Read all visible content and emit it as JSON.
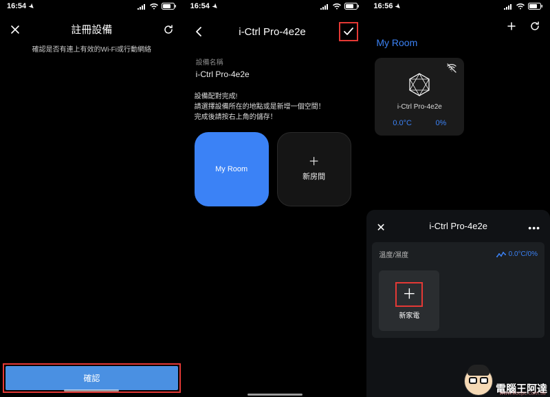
{
  "status": {
    "time1": "16:54",
    "time2": "16:54",
    "time3": "16:56"
  },
  "screen1": {
    "title": "註冊設備",
    "subtitle": "確認是否有連上有效的Wi-Fi或行動網絡",
    "confirm": "確認"
  },
  "screen2": {
    "title": "i-Ctrl Pro-4e2e",
    "deviceLabel": "設備名稱",
    "deviceName": "i-Ctrl Pro-4e2e",
    "msg_line1": "設備配對完成!",
    "msg_line2": "請選擇設備所在的地點或是新增一個空間！",
    "msg_line3": "完成後請按右上角的儲存！",
    "roomSelected": "My Room",
    "roomAdd": "新房間"
  },
  "screen3": {
    "roomTitle": "My Room",
    "deviceName": "i-Ctrl Pro-4e2e",
    "temp": "0.0°C",
    "humidity": "0%",
    "sheet": {
      "title": "i-Ctrl Pro-4e2e",
      "tempHumLabel": "溫度/濕度",
      "tempHumValue": "0.0°C/0%",
      "addAppliance": "新家電"
    }
  },
  "watermark": {
    "text": "電腦王阿達",
    "url": "www.kocpc.com.tw"
  }
}
